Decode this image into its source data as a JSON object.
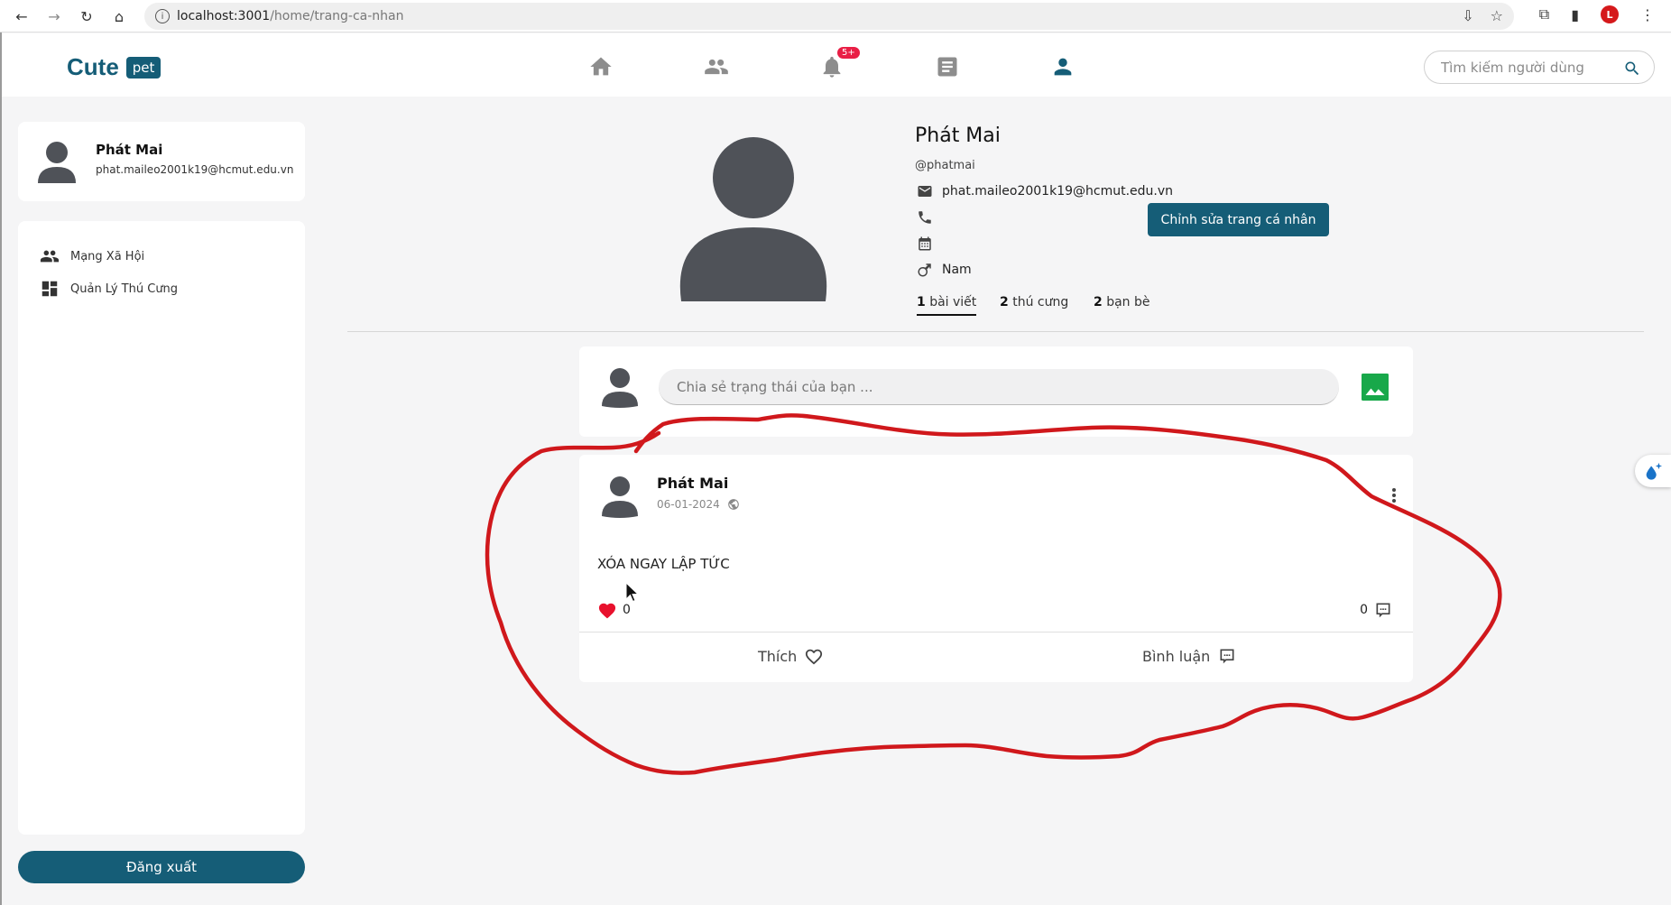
{
  "browser": {
    "url_host": "localhost:3001",
    "url_path": "/home/trang-ca-nhan",
    "profile_initial": "L"
  },
  "header": {
    "logo_text": "Cute",
    "logo_badge": "pet",
    "nav": [
      "home-icon",
      "friends-icon",
      "bell-icon",
      "article-icon",
      "person-icon"
    ],
    "notification_badge": "5+",
    "search_placeholder": "Tìm kiếm người dùng"
  },
  "sidebar": {
    "user_name": "Phát Mai",
    "user_email": "phat.maileo2001k19@hcmut.edu.vn",
    "items": [
      {
        "label": "Mạng Xã Hội",
        "icon": "people-icon"
      },
      {
        "label": "Quản Lý Thú Cưng",
        "icon": "dashboard-icon"
      }
    ],
    "logout_label": "Đăng xuất"
  },
  "profile": {
    "name": "Phát Mai",
    "handle": "@phatmai",
    "email": "phat.maileo2001k19@hcmut.edu.vn",
    "phone": "",
    "birthday": "",
    "gender": "Nam",
    "edit_label": "Chỉnh sửa trang cá nhân",
    "stats": [
      {
        "count": "1",
        "label": "bài viết"
      },
      {
        "count": "2",
        "label": "thú cưng"
      },
      {
        "count": "2",
        "label": "bạn bè"
      }
    ]
  },
  "composer": {
    "placeholder": "Chia sẻ trạng thái của bạn ..."
  },
  "post": {
    "author": "Phát Mai",
    "date": "06-01-2024",
    "content": "XÓA NGAY LẬP TỨC",
    "like_count": "0",
    "comment_count": "0",
    "like_label": "Thích",
    "comment_label": "Bình luận"
  },
  "colors": {
    "primary": "#155d77",
    "like_red": "#e8112d",
    "annotation_red": "#d0181c",
    "image_green": "#18a84a"
  }
}
